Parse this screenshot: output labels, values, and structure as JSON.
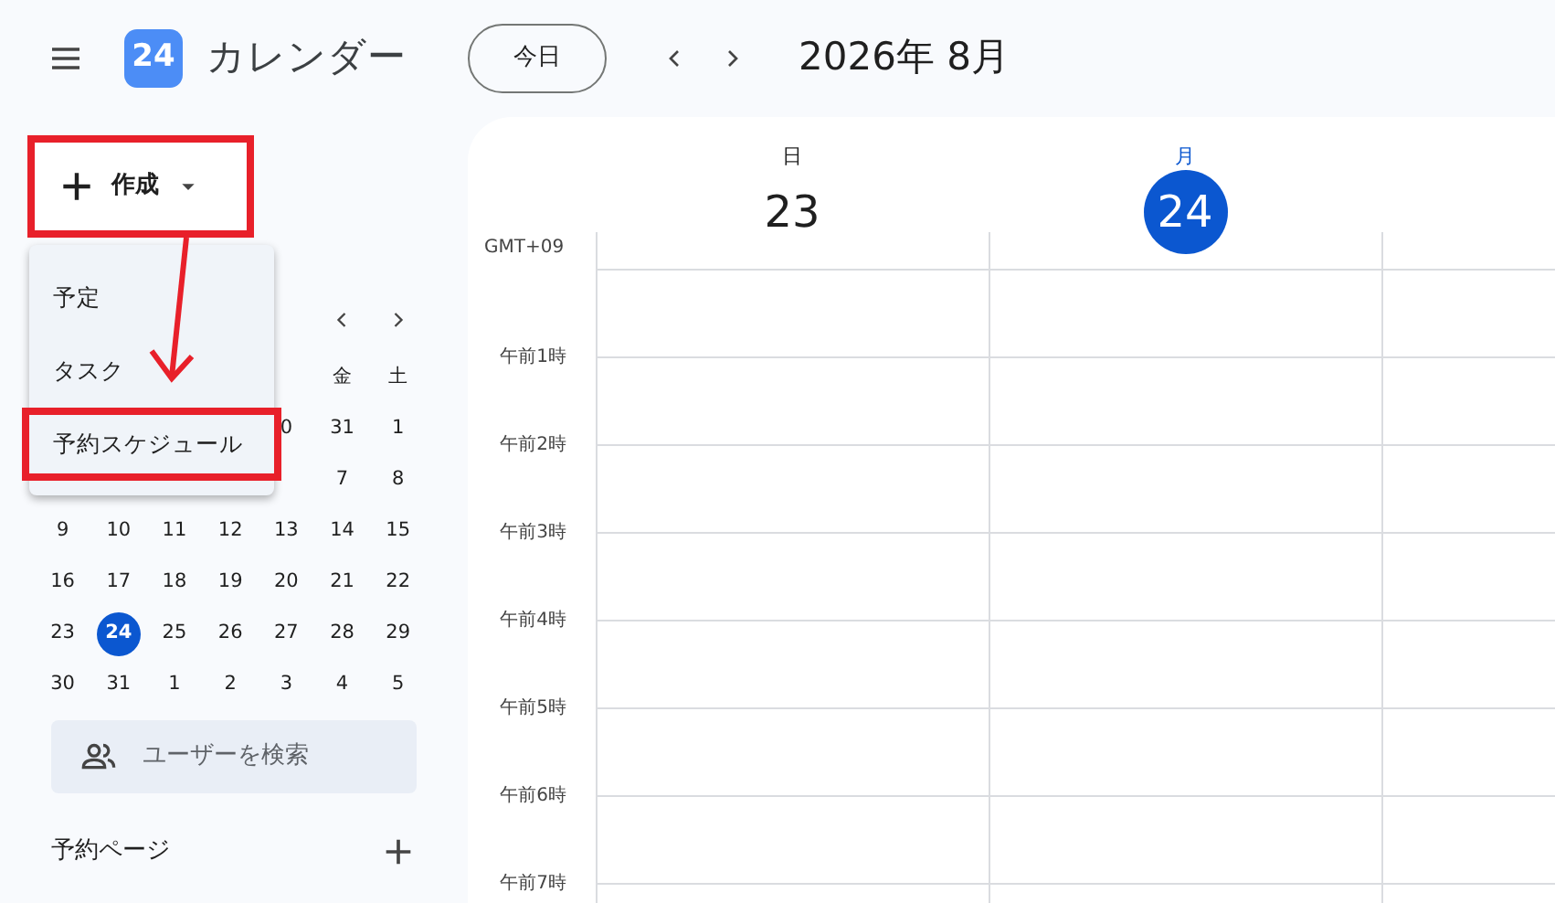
{
  "app": {
    "title": "カレンダー",
    "logo_text": "24"
  },
  "toolbar": {
    "today_button": "今日",
    "period": "2026年 8月"
  },
  "create_button": {
    "label": "作成",
    "highlighted": true
  },
  "create_menu": {
    "items": [
      {
        "label": "予定",
        "highlighted": false
      },
      {
        "label": "タスク",
        "highlighted": false
      },
      {
        "label": "予約スケジュール",
        "highlighted": true
      }
    ]
  },
  "mini_calendar": {
    "weekdays": [
      "金",
      "土"
    ],
    "weeks": [
      [
        {
          "day": "0",
          "selected": false
        },
        {
          "day": "31",
          "selected": false
        },
        {
          "day": "1",
          "selected": false
        }
      ],
      [
        {
          "day": "7",
          "selected": false
        },
        {
          "day": "8",
          "selected": false
        }
      ],
      [
        {
          "day": "9",
          "selected": false
        },
        {
          "day": "10",
          "selected": false
        },
        {
          "day": "11",
          "selected": false
        },
        {
          "day": "12",
          "selected": false
        },
        {
          "day": "13",
          "selected": false
        },
        {
          "day": "14",
          "selected": false
        },
        {
          "day": "15",
          "selected": false
        }
      ],
      [
        {
          "day": "16",
          "selected": false
        },
        {
          "day": "17",
          "selected": false
        },
        {
          "day": "18",
          "selected": false
        },
        {
          "day": "19",
          "selected": false
        },
        {
          "day": "20",
          "selected": false
        },
        {
          "day": "21",
          "selected": false
        },
        {
          "day": "22",
          "selected": false
        }
      ],
      [
        {
          "day": "23",
          "selected": false
        },
        {
          "day": "24",
          "selected": true
        },
        {
          "day": "25",
          "selected": false
        },
        {
          "day": "26",
          "selected": false
        },
        {
          "day": "27",
          "selected": false
        },
        {
          "day": "28",
          "selected": false
        },
        {
          "day": "29",
          "selected": false
        }
      ],
      [
        {
          "day": "30",
          "selected": false
        },
        {
          "day": "31",
          "selected": false
        },
        {
          "day": "1",
          "selected": false
        },
        {
          "day": "2",
          "selected": false
        },
        {
          "day": "3",
          "selected": false
        },
        {
          "day": "4",
          "selected": false
        },
        {
          "day": "5",
          "selected": false
        }
      ]
    ]
  },
  "people_search": {
    "placeholder": "ユーザーを検索"
  },
  "booking_pages": {
    "label": "予約ページ"
  },
  "week_view": {
    "timezone": "GMT+09",
    "days": [
      {
        "weekday": "日",
        "date": "23",
        "today": false
      },
      {
        "weekday": "月",
        "date": "24",
        "today": true
      }
    ],
    "hours": [
      "午前1時",
      "午前2時",
      "午前3時",
      "午前4時",
      "午前5時",
      "午前6時",
      "午前7時"
    ]
  }
}
